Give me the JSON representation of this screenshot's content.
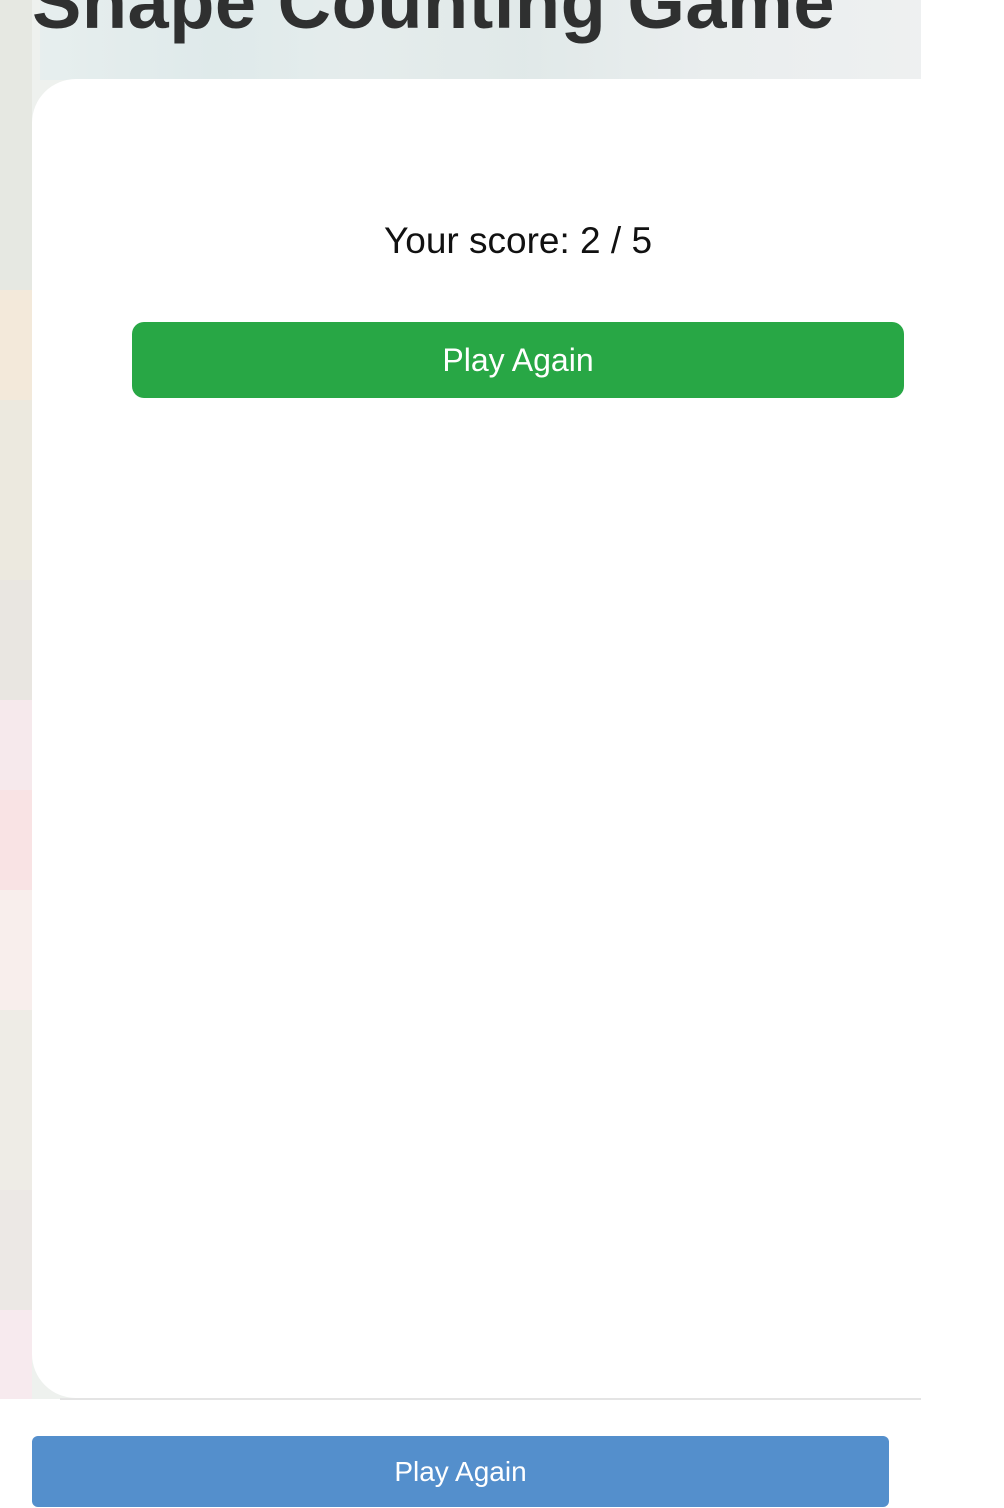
{
  "header": {
    "title": "Shape Counting Game"
  },
  "result": {
    "score_text": "Your score: 2 / 5",
    "score": 2,
    "total": 5,
    "play_again_label": "Play Again"
  },
  "footer": {
    "play_again_label": "Play Again"
  },
  "colors": {
    "primary_button": "#28a745",
    "secondary_button": "#548fcc",
    "title_text": "#2f3030"
  }
}
